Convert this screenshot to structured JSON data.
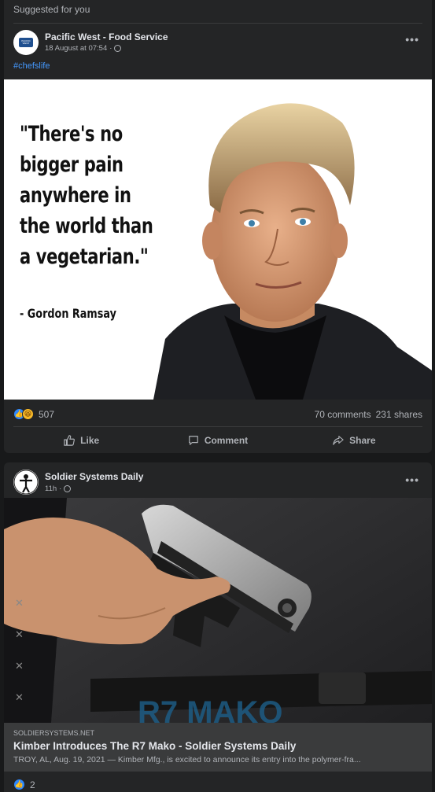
{
  "section_label": "Suggested for you",
  "post1": {
    "page_name": "Pacific West - Food Service",
    "timestamp": "18 August at 07:54",
    "separator": "·",
    "hashtag": "#chefslife",
    "logo_text": "PACIFIC WEST",
    "image": {
      "quote": "\"There's no bigger pain anywhere in the world than a vegetarian.\"",
      "attribution": "- Gordon Ramsay"
    },
    "reactions": {
      "count": "507",
      "types": [
        "like",
        "haha"
      ]
    },
    "comments": "70 comments",
    "shares": "231 shares",
    "actions": {
      "like": "Like",
      "comment": "Comment",
      "share": "Share"
    }
  },
  "post2": {
    "page_name": "Soldier Systems Daily",
    "timestamp": "11h",
    "separator": "·",
    "link": {
      "domain": "SOLDIERSYSTEMS.NET",
      "title": "Kimber Introduces The R7 Mako - Soldier Systems Daily",
      "description": "TROY, AL, Aug. 19, 2021 — Kimber Mfg., is excited to announce its entry into the polymer-fra..."
    },
    "reactions": {
      "count": "2",
      "types": [
        "like"
      ]
    }
  },
  "colors": {
    "background": "#18191a",
    "card": "#242526",
    "link": "#4599ff",
    "like_blue": "#2d88ff",
    "muted_text": "#b0b3b8"
  }
}
